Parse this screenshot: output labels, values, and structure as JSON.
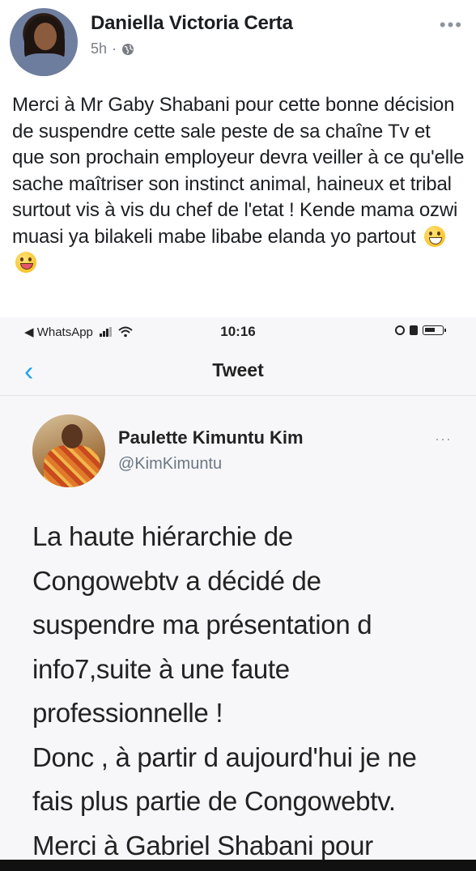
{
  "post": {
    "author": "Daniella Victoria Certa",
    "time": "5h",
    "separator": "·",
    "more": "•••",
    "text": "Merci à Mr Gaby Shabani pour cette bonne décision de suspendre cette sale peste de sa chaîne Tv et que son prochain employeur devra veiller à ce qu'elle sache maîtriser son instinct animal, haineux et tribal surtout vis à vis du chef de l'etat ! Kende mama ozwi muasi ya bilakeli mabe libabe elanda yo partout",
    "emojis": [
      "grinning-face",
      "face-with-tongue"
    ]
  },
  "screenshot": {
    "status_bar": {
      "back_app": "◀ WhatsApp",
      "time": "10:16"
    },
    "nav": {
      "back": "‹",
      "title": "Tweet"
    },
    "tweet": {
      "name": "Paulette Kimuntu Kim",
      "handle": "@KimKimuntu",
      "more": "···",
      "lines": [
        "La haute hiérarchie de",
        "Congowebtv a décidé de",
        "suspendre ma présentation d",
        "info7,suite à une faute",
        "professionnelle !",
        "Donc , à partir d aujourd'hui je ne",
        "fais plus partie de Congowebtv.",
        "Merci à Gabriel Shabani pour"
      ]
    }
  },
  "colors": {
    "twitter_blue": "#1da1f2",
    "text": "#1c1e21",
    "meta_gray": "#7a7d82"
  }
}
